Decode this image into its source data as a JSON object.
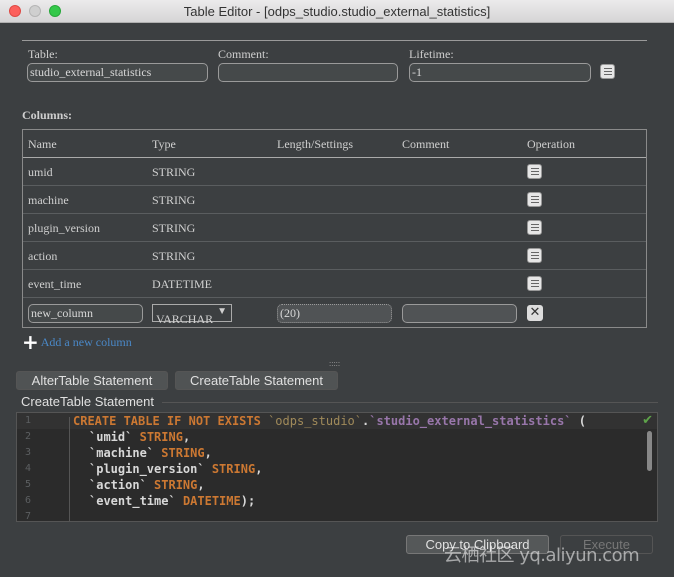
{
  "window": {
    "title": "Table Editor - [odps_studio.studio_external_statistics]"
  },
  "form": {
    "table_label": "Table:",
    "table_value": "studio_external_statistics",
    "comment_label": "Comment:",
    "comment_value": "",
    "lifetime_label": "Lifetime:",
    "lifetime_value": "-1"
  },
  "columns": {
    "label": "Columns:",
    "headers": [
      "Name",
      "Type",
      "Length/Settings",
      "Comment",
      "Operation"
    ],
    "rows": [
      {
        "name": "umid",
        "type": "STRING"
      },
      {
        "name": "machine",
        "type": "STRING"
      },
      {
        "name": "plugin_version",
        "type": "STRING"
      },
      {
        "name": "action",
        "type": "STRING"
      },
      {
        "name": "event_time",
        "type": "DATETIME"
      }
    ],
    "new_row": {
      "name": "new_column",
      "type": "VARCHAR",
      "length": "(20)",
      "comment": ""
    },
    "add_label": "Add a new column"
  },
  "tabs": {
    "alter": "AlterTable Statement",
    "create": "CreateTable Statement"
  },
  "statement": {
    "title": "CreateTable Statement",
    "line_numbers": [
      "1",
      "2",
      "3",
      "4",
      "5",
      "6",
      "7"
    ],
    "l1_kw": "CREATE TABLE IF NOT EXISTS",
    "l1_db": "`odps_studio`",
    "l1_dot": ".",
    "l1_tb": "`studio_external_statistics`",
    "l1_end": " (",
    "lines": [
      {
        "col": "`umid`",
        "type": "STRING",
        "end": ","
      },
      {
        "col": "`machine`",
        "type": "STRING",
        "end": ","
      },
      {
        "col": "`plugin_version`",
        "type": "STRING",
        "end": ","
      },
      {
        "col": "`action`",
        "type": "STRING",
        "end": ","
      },
      {
        "col": "`event_time`",
        "type": "DATETIME",
        "end": ");"
      }
    ]
  },
  "actions": {
    "copy": "Copy to Clipboard",
    "execute": "Execute"
  },
  "watermark": "云栖社区 yq.aliyun.com",
  "colors": {
    "background": "#3c3f41",
    "keyword": "#cc7832",
    "table_name": "#9876aa",
    "link": "#4a88c7"
  }
}
